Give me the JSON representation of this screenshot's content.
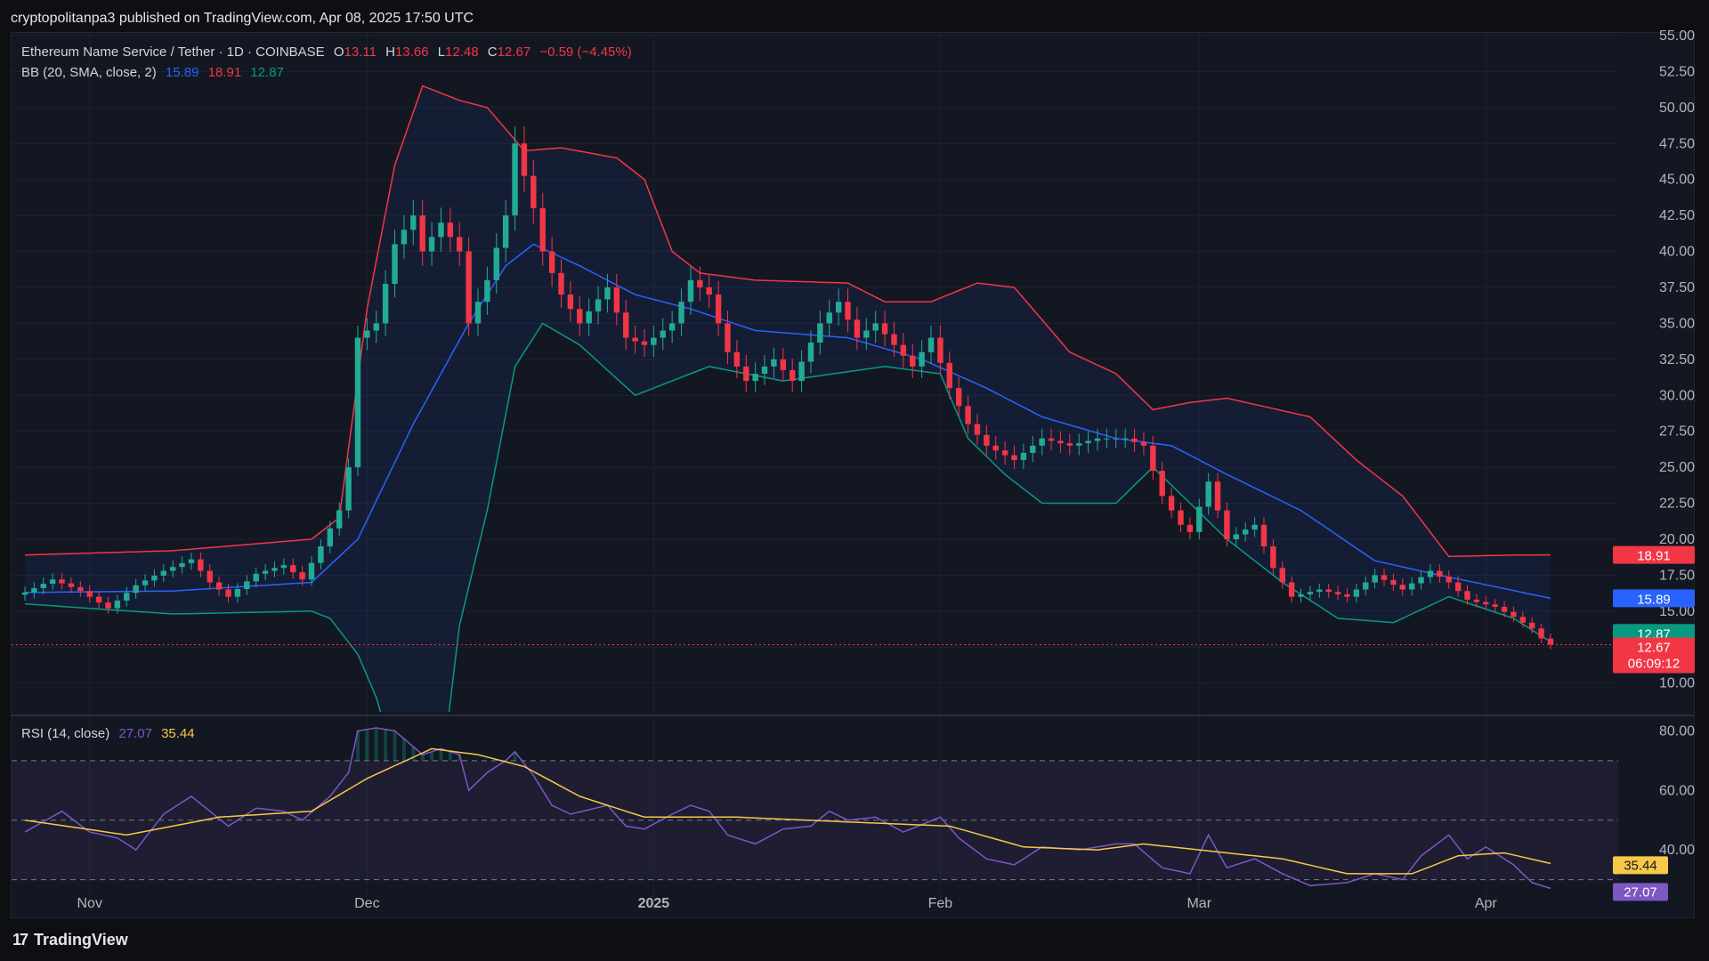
{
  "header": {
    "published": "cryptopolitanpa3 published on TradingView.com, Apr 08, 2025 17:50 UTC"
  },
  "legend": {
    "symbol": "Ethereum Name Service / Tether · 1D · COINBASE",
    "o_label": "O",
    "o": "13.11",
    "h_label": "H",
    "h": "13.66",
    "l_label": "L",
    "l": "12.48",
    "c_label": "C",
    "c": "12.67",
    "change": "−0.59 (−4.45%)",
    "bb_label": "BB (20, SMA, close, 2)",
    "bb_mid": "15.89",
    "bb_up": "18.91",
    "bb_low": "12.87"
  },
  "rsi_legend": {
    "label": "RSI (14, close)",
    "rsi": "27.07",
    "ma": "35.44"
  },
  "badges": {
    "upper": "18.91",
    "middle": "15.89",
    "lower": "12.87",
    "price": "12.67",
    "countdown": "06:09:12",
    "rsi_ma": "35.44",
    "rsi": "27.07"
  },
  "footer": {
    "brand": "TradingView",
    "logo_text": "17"
  },
  "colors": {
    "up": "#22ab94",
    "down": "#f23645",
    "bb_upper": "#f23645",
    "bb_middle": "#2962ff",
    "bb_lower": "#089981",
    "rsi": "#7e57c2",
    "rsi_ma": "#f7c948",
    "grid": "#1e222d"
  },
  "chart_data": [
    {
      "type": "candlestick",
      "title": "Ethereum Name Service / Tether · 1D · COINBASE",
      "ylim": [
        8,
        55
      ],
      "y_ticks": [
        "10.00",
        "12.50",
        "15.00",
        "17.50",
        "20.00",
        "22.50",
        "25.00",
        "27.50",
        "30.00",
        "32.50",
        "35.00",
        "37.50",
        "40.00",
        "42.50",
        "45.00",
        "47.50",
        "50.00",
        "52.50",
        "55.00"
      ],
      "x_ticks": [
        "Nov",
        "Dec",
        "2025",
        "Feb",
        "Mar",
        "Apr"
      ],
      "x_tick_dates": [
        "2024-11-01",
        "2024-12-01",
        "2025-01-01",
        "2025-02-01",
        "2025-03-01",
        "2025-04-01"
      ],
      "date_range": [
        "2024-10-25",
        "2025-04-08"
      ],
      "close_anchors": [
        [
          "2024-10-25",
          16.3
        ],
        [
          "2024-10-28",
          17.2
        ],
        [
          "2024-10-31",
          16.4
        ],
        [
          "2024-11-03",
          15.2
        ],
        [
          "2024-11-06",
          16.8
        ],
        [
          "2024-11-09",
          17.8
        ],
        [
          "2024-11-12",
          18.6
        ],
        [
          "2024-11-14",
          17.0
        ],
        [
          "2024-11-16",
          16.0
        ],
        [
          "2024-11-19",
          17.6
        ],
        [
          "2024-11-22",
          18.2
        ],
        [
          "2024-11-24",
          17.2
        ],
        [
          "2024-11-26",
          19.5
        ],
        [
          "2024-11-28",
          22.0
        ],
        [
          "2024-11-29",
          25.0
        ],
        [
          "2024-11-30",
          34.0
        ],
        [
          "2024-12-02",
          35.0
        ],
        [
          "2024-12-04",
          40.5
        ],
        [
          "2024-12-06",
          42.5
        ],
        [
          "2024-12-07",
          40.0
        ],
        [
          "2024-12-09",
          42.0
        ],
        [
          "2024-12-11",
          40.0
        ],
        [
          "2024-12-12",
          35.0
        ],
        [
          "2024-12-14",
          38.0
        ],
        [
          "2024-12-16",
          42.5
        ],
        [
          "2024-12-17",
          47.5
        ],
        [
          "2024-12-19",
          43.0
        ],
        [
          "2024-12-20",
          40.0
        ],
        [
          "2024-12-22",
          37.0
        ],
        [
          "2024-12-24",
          35.0
        ],
        [
          "2024-12-27",
          37.5
        ],
        [
          "2024-12-29",
          34.0
        ],
        [
          "2024-12-31",
          33.5
        ],
        [
          "2025-01-03",
          35.0
        ],
        [
          "2025-01-05",
          38.0
        ],
        [
          "2025-01-07",
          37.0
        ],
        [
          "2025-01-09",
          33.0
        ],
        [
          "2025-01-11",
          31.0
        ],
        [
          "2025-01-14",
          32.5
        ],
        [
          "2025-01-16",
          31.0
        ],
        [
          "2025-01-19",
          35.0
        ],
        [
          "2025-01-21",
          36.5
        ],
        [
          "2025-01-23",
          34.0
        ],
        [
          "2025-01-25",
          35.0
        ],
        [
          "2025-01-27",
          33.5
        ],
        [
          "2025-01-29",
          32.0
        ],
        [
          "2025-01-31",
          34.0
        ],
        [
          "2025-02-02",
          30.5
        ],
        [
          "2025-02-04",
          28.0
        ],
        [
          "2025-02-06",
          26.5
        ],
        [
          "2025-02-09",
          25.5
        ],
        [
          "2025-02-12",
          27.0
        ],
        [
          "2025-02-15",
          26.5
        ],
        [
          "2025-02-18",
          27.0
        ],
        [
          "2025-02-21",
          27.0
        ],
        [
          "2025-02-23",
          26.5
        ],
        [
          "2025-02-25",
          23.0
        ],
        [
          "2025-02-27",
          21.0
        ],
        [
          "2025-02-28",
          20.5
        ],
        [
          "2025-03-02",
          24.0
        ],
        [
          "2025-03-04",
          20.0
        ],
        [
          "2025-03-07",
          21.0
        ],
        [
          "2025-03-09",
          18.0
        ],
        [
          "2025-03-11",
          16.0
        ],
        [
          "2025-03-14",
          16.5
        ],
        [
          "2025-03-17",
          16.0
        ],
        [
          "2025-03-20",
          17.5
        ],
        [
          "2025-03-23",
          16.5
        ],
        [
          "2025-03-26",
          17.8
        ],
        [
          "2025-03-28",
          17.0
        ],
        [
          "2025-03-30",
          15.8
        ],
        [
          "2025-04-02",
          15.3
        ],
        [
          "2025-04-04",
          14.6
        ],
        [
          "2025-04-06",
          13.8
        ],
        [
          "2025-04-07",
          13.1
        ],
        [
          "2025-04-08",
          12.67
        ]
      ],
      "bollinger_bands": {
        "params": "20, SMA, close, 2",
        "upper": [
          [
            "2024-10-25",
            18.9
          ],
          [
            "2024-11-10",
            19.2
          ],
          [
            "2024-11-25",
            20.0
          ],
          [
            "2024-11-28",
            21.5
          ],
          [
            "2024-12-01",
            36.0
          ],
          [
            "2024-12-04",
            46.0
          ],
          [
            "2024-12-07",
            51.5
          ],
          [
            "2024-12-11",
            50.5
          ],
          [
            "2024-12-14",
            50.0
          ],
          [
            "2024-12-18",
            47.0
          ],
          [
            "2024-12-22",
            47.2
          ],
          [
            "2024-12-28",
            46.5
          ],
          [
            "2024-12-31",
            45.0
          ],
          [
            "2025-01-03",
            40.0
          ],
          [
            "2025-01-06",
            38.5
          ],
          [
            "2025-01-12",
            38.0
          ],
          [
            "2025-01-22",
            37.8
          ],
          [
            "2025-01-26",
            36.5
          ],
          [
            "2025-01-31",
            36.5
          ],
          [
            "2025-02-05",
            37.8
          ],
          [
            "2025-02-09",
            37.5
          ],
          [
            "2025-02-15",
            33.0
          ],
          [
            "2025-02-20",
            31.5
          ],
          [
            "2025-02-24",
            29.0
          ],
          [
            "2025-02-28",
            29.5
          ],
          [
            "2025-03-04",
            29.8
          ],
          [
            "2025-03-13",
            28.5
          ],
          [
            "2025-03-18",
            25.5
          ],
          [
            "2025-03-23",
            23.0
          ],
          [
            "2025-03-28",
            18.8
          ],
          [
            "2025-04-04",
            18.9
          ],
          [
            "2025-04-08",
            18.91
          ]
        ],
        "middle": [
          [
            "2024-10-25",
            16.3
          ],
          [
            "2024-11-10",
            16.4
          ],
          [
            "2024-11-25",
            17.0
          ],
          [
            "2024-11-30",
            20.0
          ],
          [
            "2024-12-06",
            28.0
          ],
          [
            "2024-12-12",
            35.0
          ],
          [
            "2024-12-16",
            39.0
          ],
          [
            "2024-12-19",
            40.5
          ],
          [
            "2024-12-24",
            39.0
          ],
          [
            "2024-12-30",
            37.0
          ],
          [
            "2025-01-05",
            36.0
          ],
          [
            "2025-01-12",
            34.5
          ],
          [
            "2025-01-22",
            34.0
          ],
          [
            "2025-01-30",
            32.5
          ],
          [
            "2025-02-06",
            30.5
          ],
          [
            "2025-02-12",
            28.5
          ],
          [
            "2025-02-20",
            27.0
          ],
          [
            "2025-02-26",
            26.5
          ],
          [
            "2025-03-04",
            24.5
          ],
          [
            "2025-03-12",
            22.0
          ],
          [
            "2025-03-20",
            18.5
          ],
          [
            "2025-03-27",
            17.5
          ],
          [
            "2025-04-02",
            16.7
          ],
          [
            "2025-04-08",
            15.89
          ]
        ],
        "lower": [
          [
            "2024-10-25",
            15.5
          ],
          [
            "2024-11-10",
            14.8
          ],
          [
            "2024-11-25",
            15.0
          ],
          [
            "2024-11-27",
            14.5
          ],
          [
            "2024-11-30",
            12.0
          ],
          [
            "2024-12-02",
            9.0
          ],
          [
            "2024-12-05",
            2.5
          ],
          [
            "2024-12-08",
            -2.0
          ],
          [
            "2024-12-11",
            14.0
          ],
          [
            "2024-12-14",
            22.0
          ],
          [
            "2024-12-17",
            32.0
          ],
          [
            "2024-12-20",
            35.0
          ],
          [
            "2024-12-24",
            33.5
          ],
          [
            "2024-12-30",
            30.0
          ],
          [
            "2025-01-03",
            31.0
          ],
          [
            "2025-01-07",
            32.0
          ],
          [
            "2025-01-15",
            31.0
          ],
          [
            "2025-01-26",
            32.0
          ],
          [
            "2025-02-01",
            31.5
          ],
          [
            "2025-02-04",
            27.0
          ],
          [
            "2025-02-08",
            24.5
          ],
          [
            "2025-02-12",
            22.5
          ],
          [
            "2025-02-20",
            22.5
          ],
          [
            "2025-02-24",
            25.0
          ],
          [
            "2025-02-28",
            22.5
          ],
          [
            "2025-03-04",
            20.0
          ],
          [
            "2025-03-10",
            17.0
          ],
          [
            "2025-03-16",
            14.5
          ],
          [
            "2025-03-22",
            14.2
          ],
          [
            "2025-03-28",
            16.0
          ],
          [
            "2025-04-04",
            14.5
          ],
          [
            "2025-04-08",
            12.87
          ]
        ]
      },
      "last_close": 12.67
    },
    {
      "type": "line",
      "title": "RSI (14, close)",
      "ylim": [
        20,
        84
      ],
      "y_ticks": [
        "40.00",
        "60.00",
        "80.00"
      ],
      "bands": [
        30,
        50,
        70
      ],
      "series": [
        {
          "name": "RSI (14, close)",
          "values": [
            [
              "2024-10-25",
              46
            ],
            [
              "2024-10-29",
              53
            ],
            [
              "2024-11-01",
              46
            ],
            [
              "2024-11-04",
              44
            ],
            [
              "2024-11-06",
              40
            ],
            [
              "2024-11-09",
              52
            ],
            [
              "2024-11-12",
              58
            ],
            [
              "2024-11-14",
              53
            ],
            [
              "2024-11-16",
              48
            ],
            [
              "2024-11-19",
              54
            ],
            [
              "2024-11-22",
              53
            ],
            [
              "2024-11-24",
              50
            ],
            [
              "2024-11-27",
              58
            ],
            [
              "2024-11-29",
              66
            ],
            [
              "2024-11-30",
              80
            ],
            [
              "2024-12-02",
              81
            ],
            [
              "2024-12-04",
              80
            ],
            [
              "2024-12-07",
              72
            ],
            [
              "2024-12-09",
              74
            ],
            [
              "2024-12-11",
              72
            ],
            [
              "2024-12-12",
              60
            ],
            [
              "2024-12-14",
              66
            ],
            [
              "2024-12-16",
              70
            ],
            [
              "2024-12-17",
              73
            ],
            [
              "2024-12-19",
              65
            ],
            [
              "2024-12-21",
              55
            ],
            [
              "2024-12-23",
              52
            ],
            [
              "2024-12-27",
              55
            ],
            [
              "2024-12-29",
              48
            ],
            [
              "2024-12-31",
              47
            ],
            [
              "2025-01-03",
              52
            ],
            [
              "2025-01-05",
              55
            ],
            [
              "2025-01-07",
              53
            ],
            [
              "2025-01-09",
              45
            ],
            [
              "2025-01-12",
              42
            ],
            [
              "2025-01-15",
              47
            ],
            [
              "2025-01-18",
              48
            ],
            [
              "2025-01-20",
              53
            ],
            [
              "2025-01-22",
              50
            ],
            [
              "2025-01-25",
              51
            ],
            [
              "2025-01-28",
              46
            ],
            [
              "2025-02-01",
              51
            ],
            [
              "2025-02-03",
              44
            ],
            [
              "2025-02-06",
              37
            ],
            [
              "2025-02-09",
              35
            ],
            [
              "2025-02-12",
              41
            ],
            [
              "2025-02-16",
              40
            ],
            [
              "2025-02-20",
              42
            ],
            [
              "2025-02-22",
              42
            ],
            [
              "2025-02-25",
              34
            ],
            [
              "2025-02-28",
              32
            ],
            [
              "2025-03-02",
              45
            ],
            [
              "2025-03-04",
              34
            ],
            [
              "2025-03-07",
              37
            ],
            [
              "2025-03-10",
              32
            ],
            [
              "2025-03-13",
              28
            ],
            [
              "2025-03-17",
              29
            ],
            [
              "2025-03-20",
              32
            ],
            [
              "2025-03-23",
              30
            ],
            [
              "2025-03-25",
              38
            ],
            [
              "2025-03-28",
              45
            ],
            [
              "2025-03-30",
              37
            ],
            [
              "2025-04-01",
              41
            ],
            [
              "2025-04-04",
              35
            ],
            [
              "2025-04-06",
              29
            ],
            [
              "2025-04-08",
              27.07
            ]
          ]
        },
        {
          "name": "RSI-based MA",
          "values": [
            [
              "2024-10-25",
              50
            ],
            [
              "2024-11-05",
              45
            ],
            [
              "2024-11-15",
              51
            ],
            [
              "2024-11-25",
              53
            ],
            [
              "2024-12-01",
              64
            ],
            [
              "2024-12-08",
              74
            ],
            [
              "2024-12-13",
              72
            ],
            [
              "2024-12-18",
              68
            ],
            [
              "2024-12-24",
              58
            ],
            [
              "2024-12-31",
              51
            ],
            [
              "2025-01-10",
              51
            ],
            [
              "2025-01-25",
              49
            ],
            [
              "2025-02-02",
              48
            ],
            [
              "2025-02-10",
              41
            ],
            [
              "2025-02-18",
              40
            ],
            [
              "2025-02-23",
              42
            ],
            [
              "2025-03-01",
              40
            ],
            [
              "2025-03-10",
              37
            ],
            [
              "2025-03-17",
              32
            ],
            [
              "2025-03-24",
              32
            ],
            [
              "2025-03-29",
              38
            ],
            [
              "2025-04-03",
              39
            ],
            [
              "2025-04-08",
              35.44
            ]
          ]
        }
      ]
    }
  ]
}
